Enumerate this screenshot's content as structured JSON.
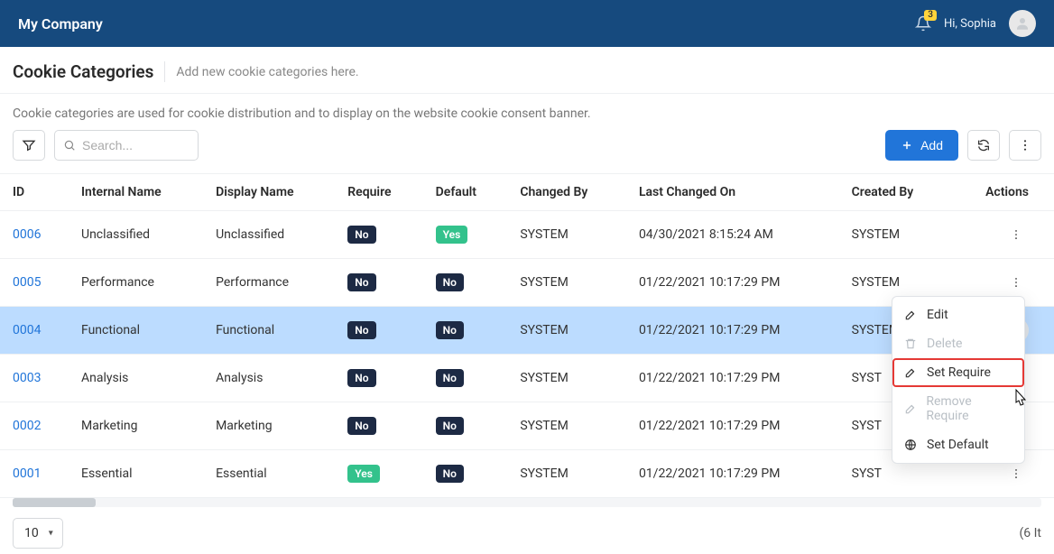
{
  "header": {
    "company": "My Company",
    "greeting": "Hi, Sophia",
    "notifications_count": "3"
  },
  "page": {
    "title": "Cookie Categories",
    "subtitle": "Add new cookie categories here.",
    "description": "Cookie categories are used for cookie distribution and to display on the website cookie consent banner."
  },
  "toolbar": {
    "search_placeholder": "Search...",
    "add_label": "Add"
  },
  "table": {
    "columns": {
      "id": "ID",
      "internal_name": "Internal Name",
      "display_name": "Display Name",
      "require": "Require",
      "default": "Default",
      "changed_by": "Changed By",
      "last_changed_on": "Last Changed On",
      "created_by": "Created By",
      "actions": "Actions"
    },
    "rows": [
      {
        "id": "0006",
        "internal_name": "Unclassified",
        "display_name": "Unclassified",
        "require": "No",
        "default": "Yes",
        "changed_by": "SYSTEM",
        "last_changed_on": "04/30/2021 8:15:24 AM",
        "created_by": "SYSTEM"
      },
      {
        "id": "0005",
        "internal_name": "Performance",
        "display_name": "Performance",
        "require": "No",
        "default": "No",
        "changed_by": "SYSTEM",
        "last_changed_on": "01/22/2021 10:17:29 PM",
        "created_by": "SYSTEM"
      },
      {
        "id": "0004",
        "internal_name": "Functional",
        "display_name": "Functional",
        "require": "No",
        "default": "No",
        "changed_by": "SYSTEM",
        "last_changed_on": "01/22/2021 10:17:29 PM",
        "created_by": "SYSTEM"
      },
      {
        "id": "0003",
        "internal_name": "Analysis",
        "display_name": "Analysis",
        "require": "No",
        "default": "No",
        "changed_by": "SYSTEM",
        "last_changed_on": "01/22/2021 10:17:29 PM",
        "created_by": "SYST"
      },
      {
        "id": "0002",
        "internal_name": "Marketing",
        "display_name": "Marketing",
        "require": "No",
        "default": "No",
        "changed_by": "SYSTEM",
        "last_changed_on": "01/22/2021 10:17:29 PM",
        "created_by": "SYST"
      },
      {
        "id": "0001",
        "internal_name": "Essential",
        "display_name": "Essential",
        "require": "Yes",
        "default": "No",
        "changed_by": "SYSTEM",
        "last_changed_on": "01/22/2021 10:17:29 PM",
        "created_by": "SYST"
      }
    ],
    "selected_row_index": 2
  },
  "footer": {
    "page_size": "10",
    "items_label": "(6 It"
  },
  "menu": {
    "edit": "Edit",
    "delete": "Delete",
    "set_require": "Set Require",
    "remove_require": "Remove Require",
    "set_default": "Set Default"
  }
}
